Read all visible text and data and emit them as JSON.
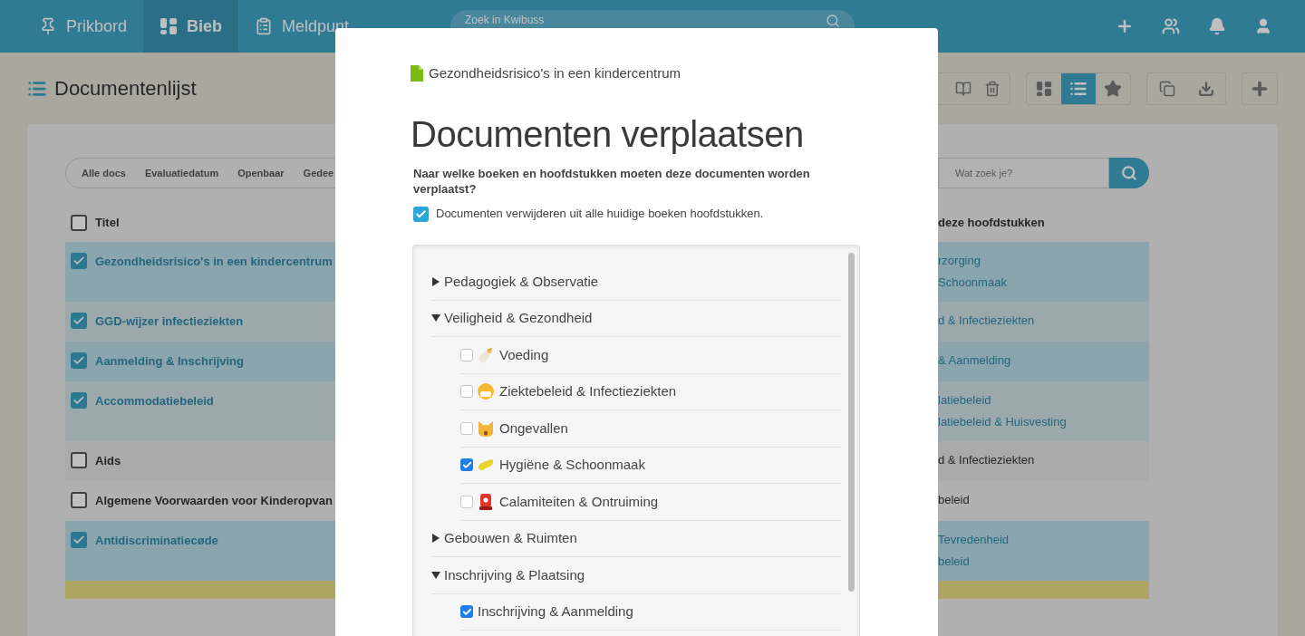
{
  "nav": {
    "tabs": [
      {
        "label": "Prikbord",
        "kind": "pin",
        "selected": false
      },
      {
        "label": "Bieb",
        "kind": "blocks",
        "selected": true
      },
      {
        "label": "Meldpunt",
        "kind": "clipboard",
        "selected": false
      }
    ],
    "search": {
      "placeholder": "Zoek in Kwibuss"
    }
  },
  "page": {
    "title": "Documentenlijst",
    "view_toggle": [
      {
        "kind": "grid",
        "selected": false
      },
      {
        "kind": "list",
        "selected": true
      },
      {
        "kind": "star",
        "selected": false
      }
    ]
  },
  "filters": [
    "Alle docs",
    "Evaluatiedatum",
    "Openbaar",
    "Gedee"
  ],
  "search": {
    "placeholder": "Wat zoek je?"
  },
  "table": {
    "columns": [
      "Titel",
      "deze hoofdstukken"
    ],
    "header_checked": false,
    "rows": [
      {
        "checked": true,
        "title": "Gezondheidsrisico's in een kindercentrum",
        "chapters": [
          "rzorging",
          "Schoonmaak"
        ]
      },
      {
        "checked": true,
        "title": "GGD-wijzer infectieziekten",
        "chapters": [
          "d & Infectieziekten"
        ]
      },
      {
        "checked": true,
        "title": "Aanmelding & Inschrijving",
        "chapters": [
          "& Aanmelding"
        ]
      },
      {
        "checked": true,
        "title": "Accommodatiebeleid",
        "chapters": [
          "latiebeleid",
          "latiebeleid & Huisvesting"
        ]
      },
      {
        "checked": false,
        "title": "Aids",
        "chapters": [
          "d & Infectieziekten"
        ]
      },
      {
        "checked": false,
        "title": "Algemene Voorwaarden voor Kinderopvan",
        "chapters": [
          "beleid"
        ]
      },
      {
        "checked": true,
        "title": "Antidiscriminatiecøde",
        "chapters": [
          "Tevredenheid",
          "beleid"
        ]
      }
    ]
  },
  "modal": {
    "document": "Gezondheidsrisico's in een kindercentrum",
    "title": "Documenten verplaatsen",
    "question": "Naar welke boeken en hoofdstukken moeten deze documenten worden verplaatst?",
    "remove_option": {
      "label": "Documenten verwijderen uit alle huidige boeken hoofdstukken.",
      "checked": true
    },
    "tree": [
      {
        "label": "Pedagogiek & Observatie",
        "expanded": false
      },
      {
        "label": "Veiligheid & Gezondheid",
        "expanded": true,
        "children": [
          {
            "label": "Voeding",
            "kind": "bottle",
            "checked": false
          },
          {
            "label": "Ziektebeleid & Infectieziekten",
            "kind": "mask",
            "checked": false
          },
          {
            "label": "Ongevallen",
            "kind": "cat",
            "checked": false
          },
          {
            "label": "Hygiëne & Schoonmaak",
            "kind": "sponge",
            "checked": true
          },
          {
            "label": "Calamiteiten & Ontruiming",
            "kind": "siren",
            "checked": false
          }
        ]
      },
      {
        "label": "Gebouwen & Ruimten",
        "expanded": false
      },
      {
        "label": "Inschrijving & Plaatsing",
        "expanded": true,
        "children": [
          {
            "label": "Inschrijving & Aanmelding",
            "kind": "plain",
            "checked": true
          }
        ]
      }
    ]
  }
}
